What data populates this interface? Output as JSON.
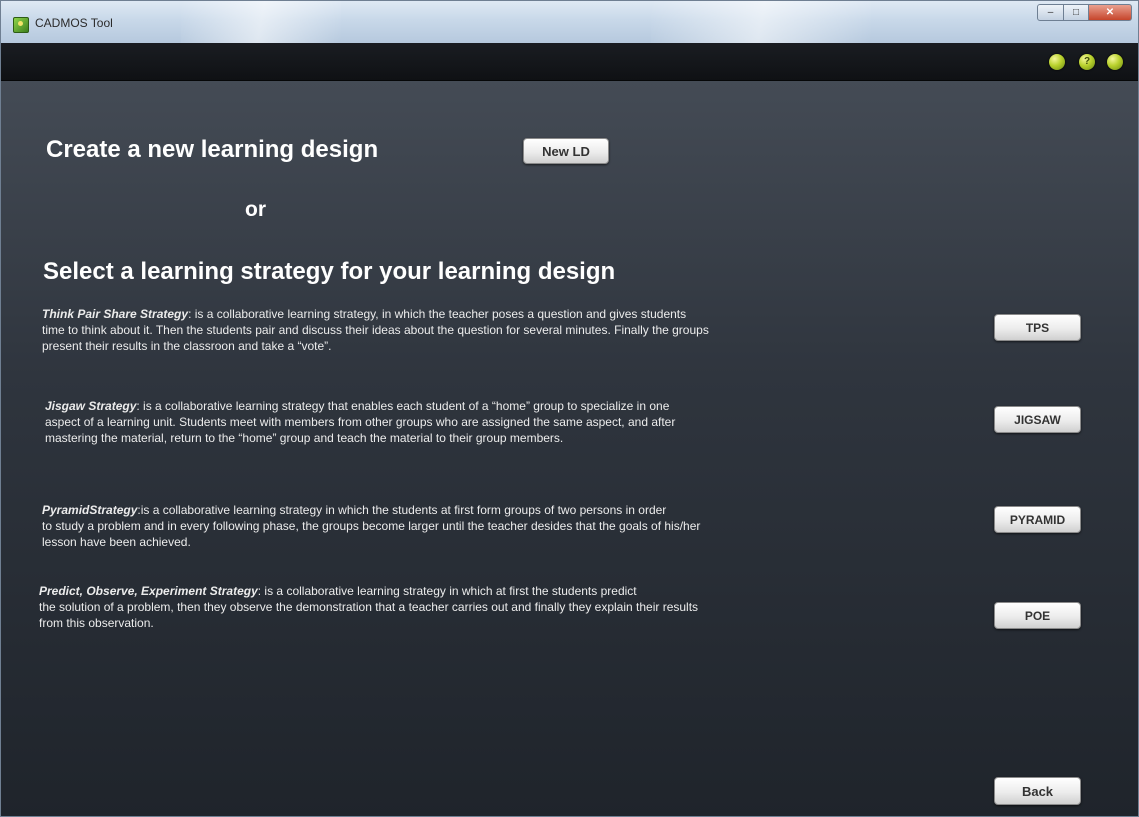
{
  "window": {
    "title": "CADMOS Tool",
    "controls": {
      "minimize": "–",
      "maximize": "□",
      "close": "✕"
    }
  },
  "toolbar": {
    "buttons": [
      {
        "icon": "info-icon",
        "glyph": ""
      },
      {
        "icon": "help-icon",
        "glyph": "?"
      },
      {
        "icon": "exit-icon",
        "glyph": ""
      }
    ]
  },
  "main": {
    "create_heading": "Create a new learning design",
    "new_ld_button": "New LD",
    "or_text": "or",
    "select_heading": "Select a learning strategy for your learning design",
    "strategies": [
      {
        "name": "Think Pair Share Strategy",
        "lines": [
          ":  is a collaborative learning strategy, in which  the teacher poses a question and gives students",
          "time to think about it. Then the students pair and discuss their ideas about the question for several minutes. Finally the groups",
          "present their results in the classroon and take a “vote”."
        ],
        "button": "TPS"
      },
      {
        "name": "Jisgaw Strategy",
        "lines": [
          ":  is a collaborative learning strategy that enables each student of a “home” group to specialize in one",
          "aspect of a learning unit. Students meet with members from other groups who are assigned the same aspect, and after",
          "mastering the material, return to the “home” group and teach the material to their group members."
        ],
        "button": "JIGSAW"
      },
      {
        "name": "PyramidStrategy",
        "lines": [
          ":is a collaborative learning strategy in which the students at first form groups of two persons in order",
          "to study a problem and in every following phase, the groups become larger until the teacher desides that the goals of his/her",
          "lesson have been achieved."
        ],
        "button": "PYRAMID"
      },
      {
        "name": "Predict, Observe, Experiment Strategy",
        "lines": [
          ": is a collaborative learning strategy in which at first the students predict",
          " the solution of a problem, then they observe the demonstration that a teacher carries out  and finally they explain their results",
          "from this observation."
        ],
        "button": "POE"
      }
    ],
    "back_button": "Back"
  },
  "colors": {
    "content_bg_top": "#444b55",
    "content_bg_bottom": "#1f242b",
    "toolbar_bg": "#1a1d22",
    "accent_circle": "#b9d12d",
    "text": "#ffffff"
  }
}
